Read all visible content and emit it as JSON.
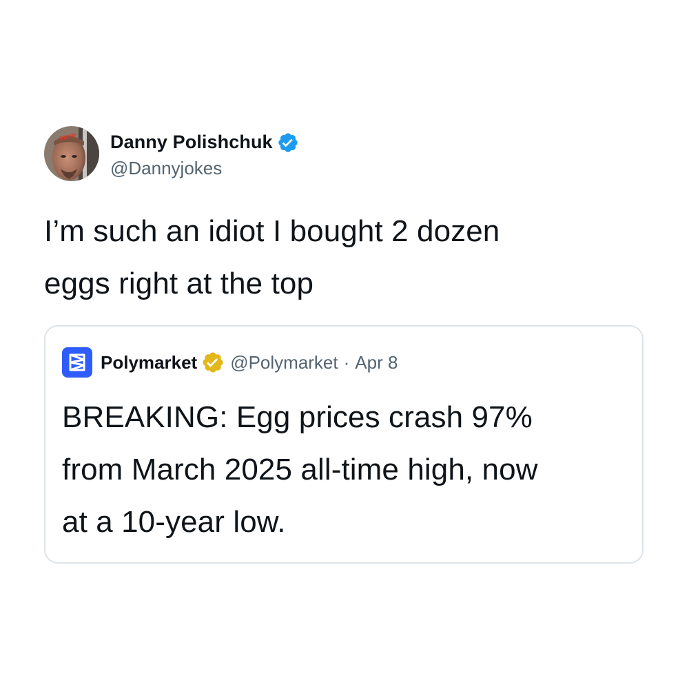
{
  "tweet": {
    "author": {
      "display_name": "Danny Polishchuk",
      "handle": "@Dannyjokes",
      "verified": true,
      "verified_badge_color": "#1d9bf0",
      "avatar_icon": "profile-photo"
    },
    "text_line1": "I’m such an idiot I bought 2 dozen",
    "text_line2": "eggs right at the top"
  },
  "quoted_tweet": {
    "author": {
      "display_name": "Polymarket",
      "handle": "@Polymarket",
      "verified": true,
      "verified_badge_color": "#e2b719",
      "avatar_color": "#2e5cff",
      "avatar_icon": "polymarket-logo"
    },
    "separator": "·",
    "date": "Apr 8",
    "text_line1": "BREAKING: Egg prices crash 97%",
    "text_line2": "from March 2025 all-time high, now",
    "text_line3": "at a 10-year low."
  }
}
